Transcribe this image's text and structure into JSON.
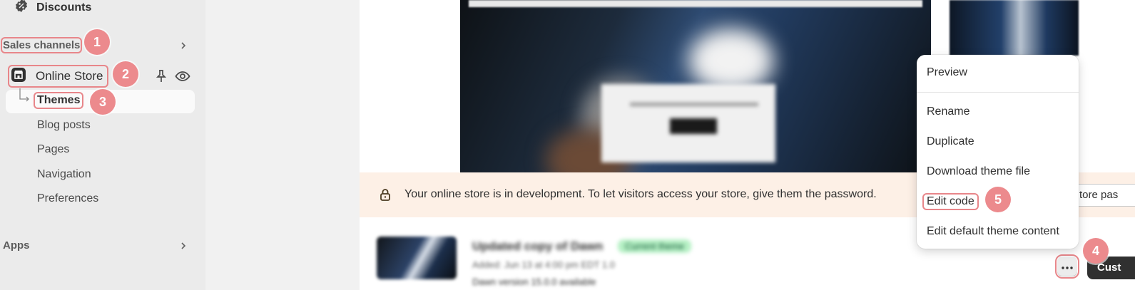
{
  "sidebar": {
    "discounts_label": "Discounts",
    "sales_channels_label": "Sales channels",
    "online_store_label": "Online Store",
    "themes_label": "Themes",
    "sub_items": [
      "Blog posts",
      "Pages",
      "Navigation",
      "Preferences"
    ],
    "apps_label": "Apps"
  },
  "banner": {
    "text": "Your online store is in development. To let visitors access your store, give them the password.",
    "password_field_value": "tore pas"
  },
  "theme": {
    "name": "Updated copy of Dawn",
    "badge": "Current theme",
    "meta": "Added: Jun 13 at 4:00 pm EDT 1.0",
    "update_notice": "Dawn version 15.0.0 available"
  },
  "actions": {
    "more_label": "···",
    "customize_label": "Cust"
  },
  "menu": {
    "items": [
      "Preview",
      "Rename",
      "Duplicate",
      "Download theme file",
      "Edit code",
      "Edit default theme content"
    ]
  },
  "annotations": [
    "1",
    "2",
    "3",
    "4",
    "5"
  ],
  "colors": {
    "highlight": "#e8868a",
    "badge": "#ec8a8d",
    "banner_bg": "#fdf0e6",
    "sidebar_bg": "#ebebeb"
  }
}
